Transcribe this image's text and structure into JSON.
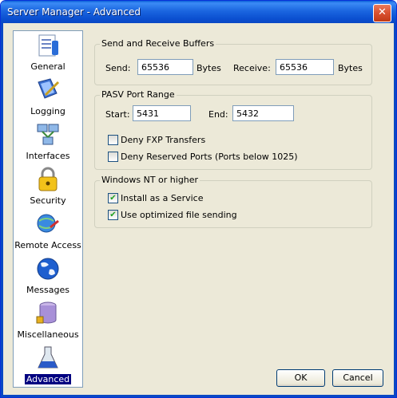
{
  "window": {
    "title": "Server Manager - Advanced",
    "close_symbol": "✕"
  },
  "sidebar": {
    "items": [
      {
        "label": "General",
        "icon": "document-info-icon"
      },
      {
        "label": "Logging",
        "icon": "book-pen-icon"
      },
      {
        "label": "Interfaces",
        "icon": "network-computers-icon"
      },
      {
        "label": "Security",
        "icon": "padlock-icon"
      },
      {
        "label": "Remote Access",
        "icon": "globe-monitor-icon"
      },
      {
        "label": "Messages",
        "icon": "globe-icon"
      },
      {
        "label": "Miscellaneous",
        "icon": "database-icon"
      },
      {
        "label": "Advanced",
        "icon": "flask-icon",
        "selected": true
      }
    ]
  },
  "buffers": {
    "title": "Send and Receive Buffers",
    "send_label": "Send:",
    "send_value": "65536",
    "send_unit": "Bytes",
    "receive_label": "Receive:",
    "receive_value": "65536",
    "receive_unit": "Bytes"
  },
  "pasv": {
    "title": "PASV Port Range",
    "start_label": "Start:",
    "start_value": "5431",
    "end_label": "End:",
    "end_value": "5432",
    "deny_fxp_label": "Deny FXP Transfers",
    "deny_fxp_checked": false,
    "deny_reserved_label": "Deny Reserved Ports (Ports below 1025)",
    "deny_reserved_checked": false
  },
  "nt": {
    "title": "Windows NT or higher",
    "service_label": "Install as a Service",
    "service_checked": true,
    "optimized_label": "Use optimized file sending",
    "optimized_checked": true
  },
  "buttons": {
    "ok": "OK",
    "cancel": "Cancel"
  }
}
